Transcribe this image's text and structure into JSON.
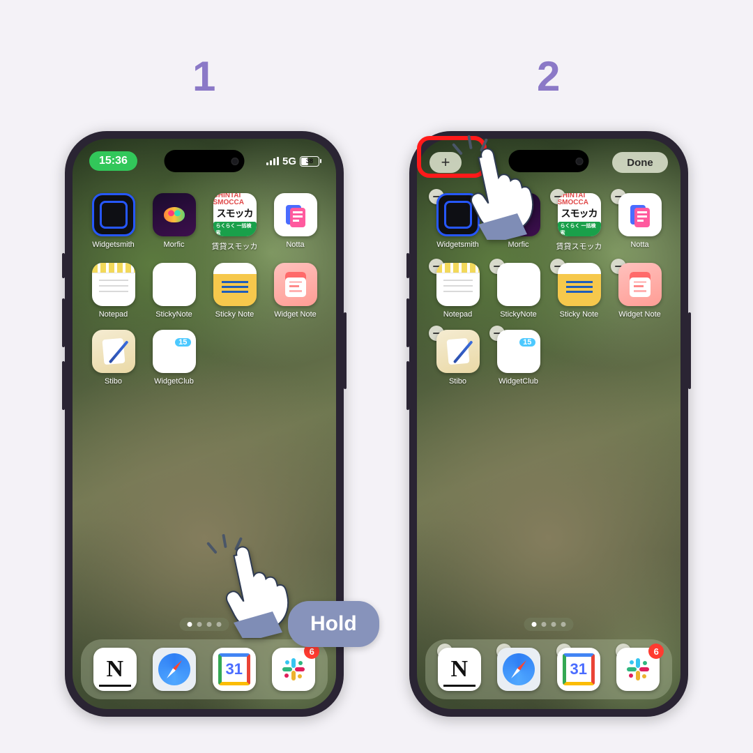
{
  "steps": {
    "one": "1",
    "two": "2"
  },
  "status": {
    "time": "15:36",
    "network": "5G",
    "battery": "38"
  },
  "edit_mode": {
    "add": "+",
    "done": "Done"
  },
  "apps": {
    "widgetsmith": "Widgetsmith",
    "morfic": "Morfic",
    "smocca": "賃貸スモッカ",
    "smocca_top": "CHINTAI SMOCCA",
    "smocca_kata": "スモッカ",
    "smocca_band": "らくらく 一括検索",
    "notta": "Notta",
    "notepad": "Notepad",
    "stickynote": "StickyNote",
    "stickynote2": "Sticky Note",
    "widgetnote": "Widget Note",
    "stibo": "Stibo",
    "widgetclub": "WidgetClub",
    "widgetclub_num": "15"
  },
  "dock": {
    "notion": "N",
    "calendar_day": "31",
    "slack_badge": "6"
  },
  "annotation": {
    "hold": "Hold"
  }
}
